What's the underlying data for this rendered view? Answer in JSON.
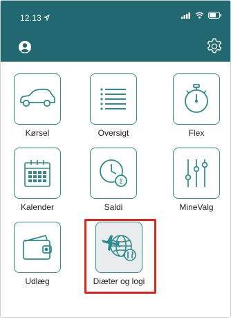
{
  "status_bar": {
    "time": "12.13",
    "icons": [
      "location-arrow-icon",
      "signal-icon",
      "wifi-icon",
      "battery-icon"
    ]
  },
  "nav_bar": {
    "icons": [
      "avatar-icon",
      "settings-gear-icon"
    ]
  },
  "tiles": [
    {
      "label": "Kørsel",
      "icon": "car-icon"
    },
    {
      "label": "Oversigt",
      "icon": "list-icon"
    },
    {
      "label": "Flex",
      "icon": "stopwatch-icon"
    },
    {
      "label": "Kalender",
      "icon": "calendar-icon"
    },
    {
      "label": "Saldi",
      "icon": "clock-sum-icon"
    },
    {
      "label": "MineValg",
      "icon": "sliders-icon"
    },
    {
      "label": "Udlæg",
      "icon": "wallet-icon"
    },
    {
      "label": "Diæter og logi",
      "icon": "plane-globe-cutlery-icon"
    }
  ],
  "colors": {
    "header": "#226870",
    "icon_stroke": "#2d8a8e",
    "highlight": "#e2231a"
  }
}
